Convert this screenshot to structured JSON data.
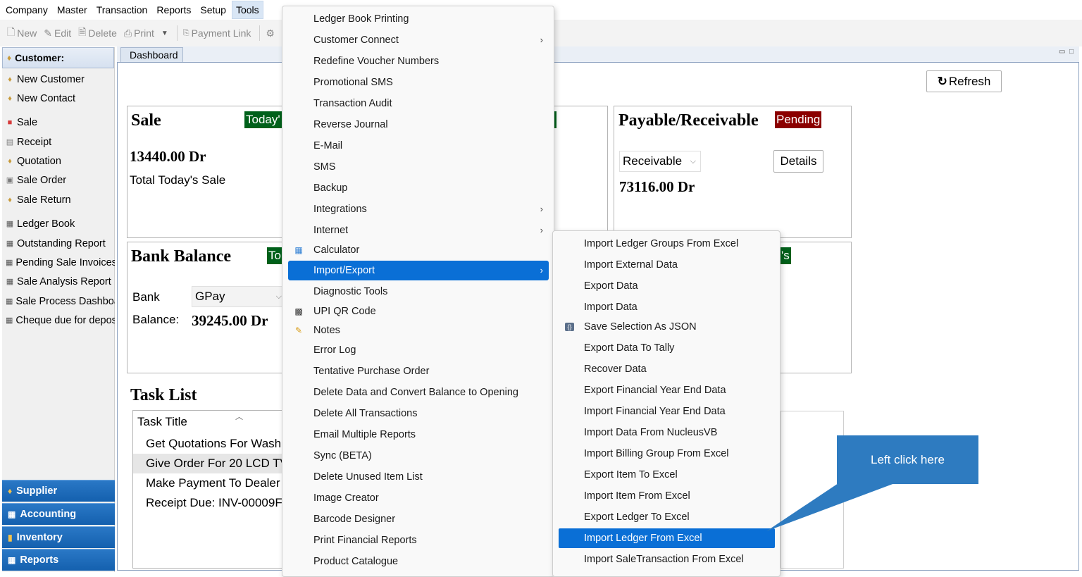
{
  "menubar": [
    "Company",
    "Master",
    "Transaction",
    "Reports",
    "Setup",
    "Tools"
  ],
  "toolbar": {
    "new": "New",
    "edit": "Edit",
    "delete": "Delete",
    "print": "Print",
    "payment_link": "Payment Link"
  },
  "sidebar": {
    "header": "Customer:",
    "items": [
      "New Customer",
      "New Contact",
      "Sale",
      "Receipt",
      "Quotation",
      "Sale Order",
      "Sale Return",
      "Ledger Book",
      "Outstanding Report",
      "Pending Sale Invoices",
      "Sale Analysis Report",
      "Sale Process Dashboa",
      "Cheque due for depos"
    ],
    "groups": [
      "Supplier",
      "Accounting",
      "Inventory",
      "Reports"
    ]
  },
  "dashboard": {
    "tab": "Dashboard",
    "refresh": "Refresh",
    "sale": {
      "title": "Sale",
      "badge": "Today'",
      "value": "13440.00 Dr",
      "caption": "Total Today's Sale"
    },
    "payable": {
      "title": "Payable/Receivable",
      "badge": "Pending",
      "select": "Receivable",
      "details": "Details",
      "value": "73116.00 Dr"
    },
    "bank": {
      "title": "Bank Balance",
      "badge": "To",
      "bank_label": "Bank",
      "bank_value": "GPay",
      "balance_label": "Balance:",
      "balance_value": "39245.00 Dr"
    },
    "right_badge": "'s",
    "task": {
      "title": "Task List",
      "column": "Task Title",
      "rows": [
        "Get Quotations For Wash",
        "Give Order For 20 LCD TV",
        "Make Payment To Dealer",
        "Receipt Due: INV-00009F"
      ]
    }
  },
  "tools_menu": [
    {
      "label": "Ledger Book Printing"
    },
    {
      "label": "Customer Connect",
      "arrow": "›"
    },
    {
      "label": "Redefine Voucher Numbers"
    },
    {
      "label": "Promotional SMS"
    },
    {
      "label": "Transaction Audit"
    },
    {
      "label": "Reverse Journal"
    },
    {
      "label": "E-Mail"
    },
    {
      "label": "SMS"
    },
    {
      "label": "Backup"
    },
    {
      "label": "Integrations",
      "arrow": "›"
    },
    {
      "label": "Internet",
      "arrow": "›"
    },
    {
      "label": "Calculator"
    },
    {
      "label": "Import/Export",
      "arrow": "›"
    },
    {
      "label": "Diagnostic Tools"
    },
    {
      "label": "UPI QR Code"
    },
    {
      "label": "Notes"
    },
    {
      "label": "Error Log"
    },
    {
      "label": "Tentative Purchase Order"
    },
    {
      "label": "Delete Data and Convert Balance to Opening"
    },
    {
      "label": "Delete All Transactions"
    },
    {
      "label": "Email Multiple Reports"
    },
    {
      "label": "Sync (BETA)"
    },
    {
      "label": "Delete Unused Item List"
    },
    {
      "label": "Image Creator"
    },
    {
      "label": "Barcode Designer"
    },
    {
      "label": "Print Financial Reports"
    },
    {
      "label": "Product Catalogue"
    }
  ],
  "submenu": [
    "Import Ledger Groups From Excel",
    "Import External Data",
    "Export Data",
    "Import Data",
    "Save Selection As JSON",
    "Export Data To Tally",
    "Recover Data",
    "Export Financial Year End Data",
    "Import Financial Year End Data",
    "Import Data From NucleusVB",
    "Import Billing Group From Excel",
    "Export Item To Excel",
    "Import Item From Excel",
    "Export Ledger To Excel",
    "Import Ledger From Excel",
    "Import  SaleTransaction From Excel"
  ],
  "callout": "Left click here",
  "colors": {
    "accent": "#0a6fd6",
    "nav_group": "#1a6bbd",
    "badge_green": "#00601a",
    "badge_red": "#8b0000",
    "callout": "#2e7bc0"
  }
}
